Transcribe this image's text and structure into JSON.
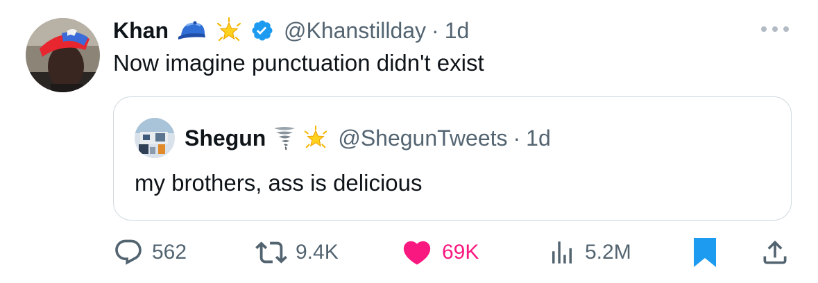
{
  "tweet": {
    "author": {
      "name": "Khan",
      "handle": "@Khanstillday",
      "time": "1d",
      "badges": [
        "blue-cap-emoji",
        "glowing-star-emoji",
        "verified-badge"
      ]
    },
    "text": "Now imagine punctuation didn't exist",
    "quote": {
      "author": {
        "name": "Shegun",
        "handle": "@ShegunTweets",
        "time": "1d",
        "badges": [
          "tornado-emoji",
          "glowing-star-emoji"
        ]
      },
      "text": "my brothers, ass is delicious"
    },
    "actions": {
      "replies": "562",
      "reposts": "9.4K",
      "likes": "69K",
      "views": "5.2M"
    }
  },
  "separator": "·",
  "colors": {
    "secondary_text": "#536471",
    "like": "#f91880",
    "bookmark": "#1d9bf0",
    "verified": "#1d9bf0",
    "border": "#cfd9de"
  }
}
